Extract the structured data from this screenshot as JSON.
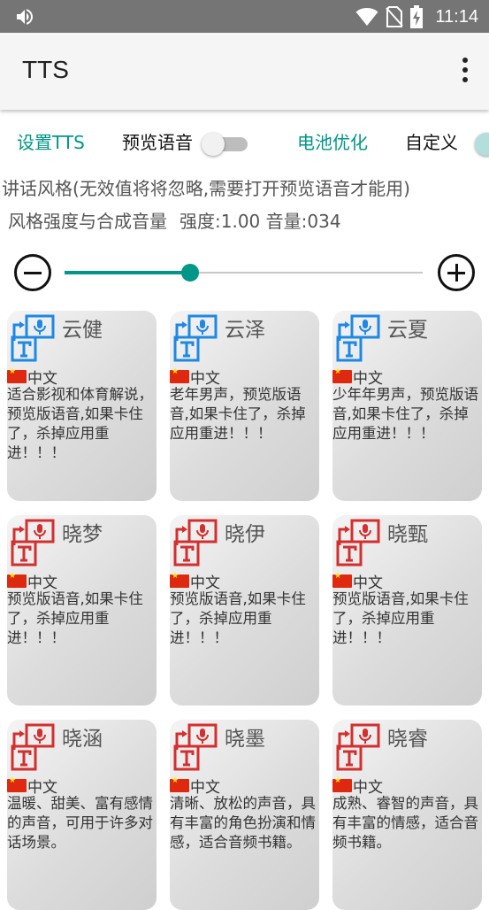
{
  "status_bar": {
    "time": "11:14"
  },
  "app_bar": {
    "title": "TTS"
  },
  "controls": {
    "setup_tts": "设置TTS",
    "preview_voice": "预览语音",
    "battery_opt": "电池优化",
    "custom": "自定义"
  },
  "style": {
    "description": "讲话风格(无效值将将忽略,需要打开预览语音才能用)",
    "strength_label": "风格强度与合成音量",
    "strength_value": "强度:1.00 音量:034",
    "slider_fraction": 0.35
  },
  "colors": {
    "accent": "#009688",
    "blue_icon": "#1e88e5",
    "red_icon": "#d32f2f"
  },
  "voices": [
    {
      "name": "云健",
      "lang": "中文",
      "desc": "适合影视和体育解说，预览版语音,如果卡住了，杀掉应用重进！！！",
      "icon_color": "blue"
    },
    {
      "name": "云泽",
      "lang": "中文",
      "desc": "老年男声，预览版语音,如果卡住了，杀掉应用重进！！！",
      "icon_color": "blue"
    },
    {
      "name": "云夏",
      "lang": "中文",
      "desc": "少年年男声，预览版语音,如果卡住了，杀掉应用重进！！！",
      "icon_color": "blue"
    },
    {
      "name": "晓梦",
      "lang": "中文",
      "desc": "预览版语音,如果卡住了，杀掉应用重进！！！",
      "icon_color": "red"
    },
    {
      "name": "晓伊",
      "lang": "中文",
      "desc": "预览版语音,如果卡住了，杀掉应用重进！！！",
      "icon_color": "red"
    },
    {
      "name": "晓甄",
      "lang": "中文",
      "desc": "预览版语音,如果卡住了，杀掉应用重进！！！",
      "icon_color": "red"
    },
    {
      "name": "晓涵",
      "lang": "中文",
      "desc": "温暖、甜美、富有感情的声音，可用于许多对话场景。",
      "icon_color": "red"
    },
    {
      "name": "晓墨",
      "lang": "中文",
      "desc": "清晰、放松的声音，具有丰富的角色扮演和情感，适合音频书籍。",
      "icon_color": "red"
    },
    {
      "name": "晓睿",
      "lang": "中文",
      "desc": "成熟、睿智的声音，具有丰富的情感，适合音频书籍。",
      "icon_color": "red"
    }
  ]
}
